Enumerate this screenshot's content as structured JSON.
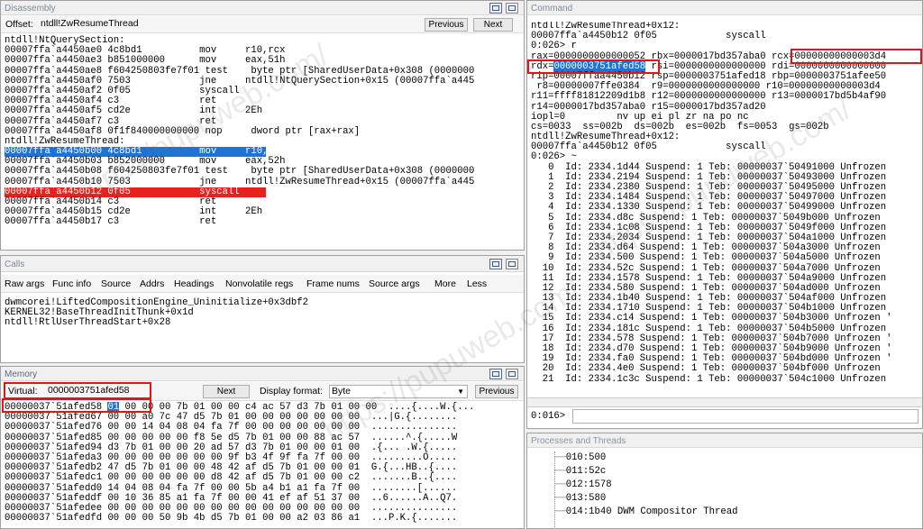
{
  "disassembly": {
    "title": "Disassembly",
    "offset_label": "Offset:",
    "offset_value": "ntdll!ZwResumeThread",
    "prev_button": "Previous",
    "next_button": "Next",
    "lines": [
      {
        "text": "ntdll!NtQuerySection:",
        "hl": ""
      },
      {
        "text": "00007ffa`a4450ae0 4c8bd1          mov     r10,rcx",
        "hl": ""
      },
      {
        "text": "00007ffa`a4450ae3 b851000000      mov     eax,51h",
        "hl": ""
      },
      {
        "text": "00007ffa`a4450ae8 f604250803fe7f01 test    byte ptr [SharedUserData+0x308 (0000000",
        "hl": ""
      },
      {
        "text": "00007ffa`a4450af0 7503            jne     ntdll!NtQuerySection+0x15 (00007ffa`a445",
        "hl": ""
      },
      {
        "text": "00007ffa`a4450af2 0f05            syscall",
        "hl": ""
      },
      {
        "text": "00007ffa`a4450af4 c3              ret",
        "hl": ""
      },
      {
        "text": "00007ffa`a4450af5 cd2e            int     2Eh",
        "hl": ""
      },
      {
        "text": "00007ffa`a4450af7 c3              ret",
        "hl": ""
      },
      {
        "text": "00007ffa`a4450af8 0f1f840000000000 nop     dword ptr [rax+rax]",
        "hl": ""
      },
      {
        "text": "ntdll!ZwResumeThread:",
        "hl": ""
      },
      {
        "text": "00007ffa`a4450b00 4c8bd1          mov     r10,rcx",
        "hl": "blue"
      },
      {
        "text": "00007ffa`a4450b03 b852000000      mov     eax,52h",
        "hl": ""
      },
      {
        "text": "00007ffa`a4450b08 f604250803fe7f01 test    byte ptr [SharedUserData+0x308 (0000000",
        "hl": ""
      },
      {
        "text": "00007ffa`a4450b10 7503            jne     ntdll!ZwResumeThread+0x15 (00007ffa`a445",
        "hl": ""
      },
      {
        "text": "00007ffa`a4450b12 0f05            syscall",
        "hl": "red"
      },
      {
        "text": "00007ffa`a4450b14 c3              ret",
        "hl": ""
      },
      {
        "text": "00007ffa`a4450b15 cd2e            int     2Eh",
        "hl": ""
      },
      {
        "text": "00007ffa`a4450b17 c3              ret",
        "hl": ""
      }
    ]
  },
  "calls": {
    "title": "Calls",
    "toolbar": [
      "Raw args",
      "Func info",
      "Source",
      "Addrs",
      "Headings",
      "Nonvolatile regs",
      "Frame nums",
      "Source args",
      "More",
      "Less"
    ],
    "lines": [
      "dwmcorei!LiftedCompositionEngine_Uninitialize+0x3dbf2",
      "KERNEL32!BaseThreadInitThunk+0x1d",
      "ntdll!RtlUserThreadStart+0x28"
    ]
  },
  "memory": {
    "title": "Memory",
    "virtual_label": "Virtual:",
    "virtual_value": "0000003751afed58",
    "next_button": "Next",
    "display_format_label": "Display format:",
    "display_format_value": "Byte",
    "prev_button": "Previous",
    "rows": [
      {
        "addr": "00000037`51afed58",
        "bytes_pre": "",
        "sel": "01",
        "bytes": " 00 00 00 7b 01 00 00 c4 ac 57 d3 7b 01 00 00",
        "ascii": "....{....W.{..."
      },
      {
        "addr": "00000037`51afed67",
        "bytes_pre": "",
        "sel": "",
        "bytes": "00 00 a0 7c 47 d5 7b 01 00 00 00 00 00 00 00",
        "ascii": "...|G.{........"
      },
      {
        "addr": "00000037`51afed76",
        "bytes_pre": "",
        "sel": "",
        "bytes": "00 00 14 04 08 04 fa 7f 00 00 00 00 00 00 00",
        "ascii": "..............."
      },
      {
        "addr": "00000037`51afed85",
        "bytes_pre": "",
        "sel": "",
        "bytes": "00 00 00 00 00 f8 5e d5 7b 01 00 00 88 ac 57",
        "ascii": "......^.{.....W"
      },
      {
        "addr": "00000037`51afed94",
        "bytes_pre": "",
        "sel": "",
        "bytes": "d3 7b 01 00 00 20 ad 57 d3 7b 01 00 00 01 00",
        "ascii": ".{... .W.{....."
      },
      {
        "addr": "00000037`51afeda3",
        "bytes_pre": "",
        "sel": "",
        "bytes": "00 00 00 00 00 00 00 9f b3 4f 9f fa 7f 00 00",
        "ascii": ".........O....."
      },
      {
        "addr": "00000037`51afedb2",
        "bytes_pre": "",
        "sel": "",
        "bytes": "47 d5 7b 01 00 00 48 42 af d5 7b 01 00 00 01",
        "ascii": "G.{...HB..{...."
      },
      {
        "addr": "00000037`51afedc1",
        "bytes_pre": "",
        "sel": "",
        "bytes": "00 00 00 00 00 00 d8 42 af d5 7b 01 00 00 c2",
        "ascii": ".......B..{...."
      },
      {
        "addr": "00000037`51afedd0",
        "bytes_pre": "",
        "sel": "",
        "bytes": "14 04 08 04 fa 7f 00 00 5b a4 b1 a1 fa 7f 00",
        "ascii": "........[......"
      },
      {
        "addr": "00000037`51afeddf",
        "bytes_pre": "",
        "sel": "",
        "bytes": "00 10 36 85 a1 fa 7f 00 00 41 ef af 51 37 00",
        "ascii": "..6......A..Q7."
      },
      {
        "addr": "00000037`51afedee",
        "bytes_pre": "",
        "sel": "",
        "bytes": "00 00 00 00 00 00 00 00 00 00 00 00 00 00 00",
        "ascii": "..............."
      },
      {
        "addr": "00000037`51afedfd",
        "bytes_pre": "",
        "sel": "",
        "bytes": "00 00 00 50 9b 4b d5 7b 01 00 00 a2 03 86 a1",
        "ascii": "...P.K.{......."
      }
    ]
  },
  "command": {
    "title": "Command",
    "lines": [
      "ntdll!ZwResumeThread+0x12:",
      "00007ffa`a4450b12 0f05            syscall",
      "0:026> r",
      "rax=0000000000000052 rbx=0000017bd357aba0 rcx=00000000000003d4",
      "rdx=0000003751afed58 rsi=0000000000000000 rdi=0000000000000000",
      "rip=00007ffaa4450b12 rsp=0000003751afed18 rbp=0000003751afee50",
      " r8=00000007ffe0384  r9=0000000000000000 r10=00000000000003d4",
      "r11=ffff81812209d1b8 r12=0000000000000000 r13=0000017bd5b4af90",
      "r14=0000017bd357aba0 r15=0000017bd357ad20",
      "iopl=0         nv up ei pl zr na po nc",
      "cs=0033  ss=002b  ds=002b  es=002b  fs=0053  gs=002b",
      "ntdll!ZwResumeThread+0x12:",
      "00007ffa`a4450b12 0f05            syscall",
      "0:026> ~",
      "   0  Id: 2334.1d44 Suspend: 1 Teb: 00000037`50491000 Unfrozen",
      "   1  Id: 2334.2194 Suspend: 1 Teb: 00000037`50493000 Unfrozen",
      "   2  Id: 2334.2380 Suspend: 1 Teb: 00000037`50495000 Unfrozen",
      "   3  Id: 2334.1484 Suspend: 1 Teb: 00000037`50497000 Unfrozen",
      "   4  Id: 2334.1330 Suspend: 1 Teb: 00000037`50499000 Unfrozen",
      "   5  Id: 2334.d8c Suspend: 1 Teb: 00000037`5049b000 Unfrozen",
      "   6  Id: 2334.1c08 Suspend: 1 Teb: 00000037`5049f000 Unfrozen",
      "   7  Id: 2334.2034 Suspend: 1 Teb: 00000037`504a1000 Unfrozen",
      "   8  Id: 2334.d64 Suspend: 1 Teb: 00000037`504a3000 Unfrozen",
      "   9  Id: 2334.500 Suspend: 1 Teb: 00000037`504a5000 Unfrozen",
      "  10  Id: 2334.52c Suspend: 1 Teb: 00000037`504a7000 Unfrozen",
      "  11  Id: 2334.1578 Suspend: 1 Teb: 00000037`504a9000 Unfrozen",
      "  12  Id: 2334.580 Suspend: 1 Teb: 00000037`504ad000 Unfrozen",
      "  13  Id: 2334.1b40 Suspend: 1 Teb: 00000037`504af000 Unfrozen",
      "  14  Id: 2334.1710 Suspend: 1 Teb: 00000037`504b1000 Unfrozen",
      "  15  Id: 2334.c14 Suspend: 1 Teb: 00000037`504b3000 Unfrozen '",
      "  16  Id: 2334.181c Suspend: 1 Teb: 00000037`504b5000 Unfrozen",
      "  17  Id: 2334.578 Suspend: 1 Teb: 00000037`504b7000 Unfrozen '",
      "  18  Id: 2334.d70 Suspend: 1 Teb: 00000037`504b9000 Unfrozen '",
      "  19  Id: 2334.fa0 Suspend: 1 Teb: 00000037`504bd000 Unfrozen '",
      "  20  Id: 2334.4e0 Suspend: 1 Teb: 00000037`504bf000 Unfrozen",
      "  21  Id: 2334.1c3c Suspend: 1 Teb: 00000037`504c1000 Unfrozen"
    ],
    "prompt": "0:016>",
    "input_value": ""
  },
  "processes": {
    "title": "Processes and Threads",
    "items": [
      "010:500",
      "011:52c",
      "012:1578",
      "013:580",
      "014:1b40 DWM Compositor Thread"
    ]
  },
  "watermark": "https://pupuweb.com/"
}
